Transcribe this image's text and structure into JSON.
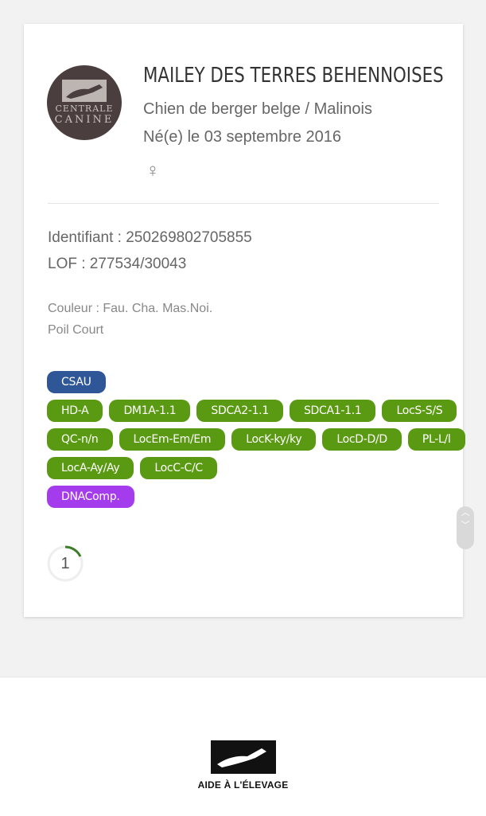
{
  "dog": {
    "logo_line1": "CENTRALE",
    "logo_line2": "CANINE",
    "name": "MAILEY DES TERRES BEHENNOISES",
    "breed": "Chien de berger belge / Malinois",
    "born": "Né(e) le 03 septembre 2016",
    "gender_symbol": "♀",
    "identifiant": "Identifiant : 250269802705855",
    "lof": "LOF : 277534/30043",
    "couleur": "Couleur : Fau. Cha. Mas.Noi.",
    "poil": "Poil Court"
  },
  "badges": [
    [
      "CSAU"
    ],
    [
      "HD-A",
      "DM1A-1.1",
      "SDCA2-1.1",
      "SDCA1-1.1",
      "LocS-S/S"
    ],
    [
      "QC-n/n",
      "LocEm-Em/Em",
      "LocK-ky/ky",
      "LocD-D/D",
      "PL-L/l"
    ],
    [
      "LocA-Ay/Ay",
      "LocC-C/C"
    ],
    [
      "DNAComp."
    ]
  ],
  "colors": {
    "green": "#5a9a12",
    "blue": "#2f5797",
    "purple": "#a43cee"
  },
  "spinner": {
    "value": "1"
  },
  "footer": {
    "label": "AIDE À L'ÉLEVAGE"
  }
}
